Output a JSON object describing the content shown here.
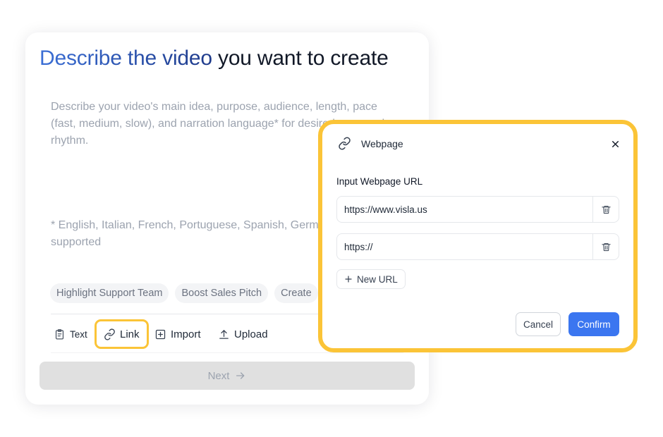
{
  "main": {
    "title_highlight": "Describe the video",
    "title_rest": "you want to create",
    "placeholder": "Describe your video's main idea, purpose, audience, length, pace (fast, medium, slow), and narration language* for desired pace and rhythm.",
    "languages_note": "* English, Italian, French, Portuguese, Spanish, German, … are supported",
    "chips": [
      "Highlight Support Team",
      "Boost Sales Pitch",
      "Create"
    ],
    "tools": {
      "text": "Text",
      "link": "Link",
      "import": "Import",
      "upload": "Upload"
    },
    "next_label": "Next"
  },
  "modal": {
    "title": "Webpage",
    "field_label": "Input Webpage URL",
    "urls": [
      "https://www.visla.us",
      "https://"
    ],
    "new_url_label": "New URL",
    "cancel_label": "Cancel",
    "confirm_label": "Confirm"
  },
  "colors": {
    "highlight_ring": "#fbc437",
    "confirm_button": "#3b76f0",
    "title_gradient_start": "#3b6fd6",
    "title_gradient_end": "#1e3a8a"
  }
}
